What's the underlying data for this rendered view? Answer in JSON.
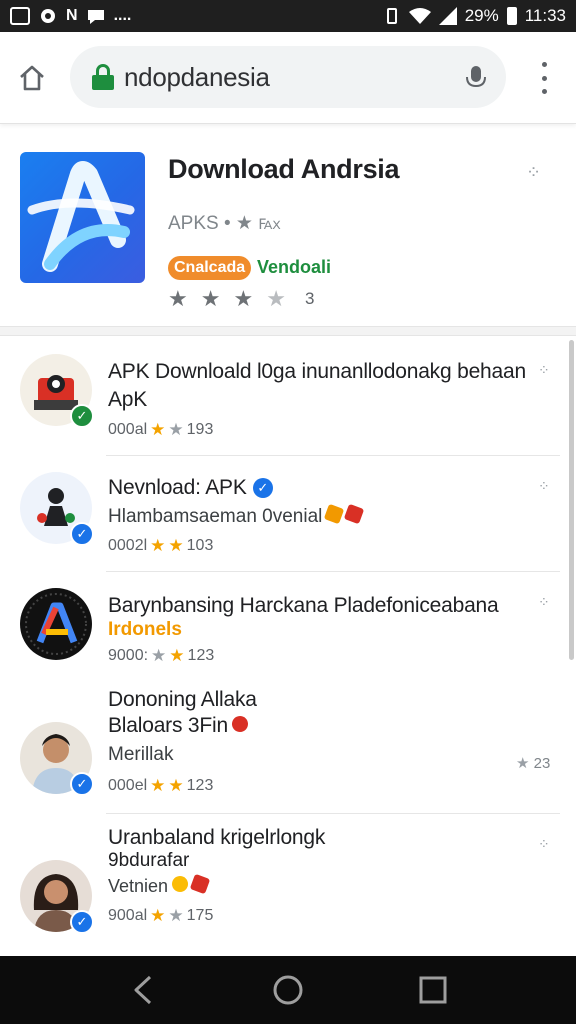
{
  "status_bar": {
    "left_glyphs": [
      "N",
      "...."
    ],
    "battery_text": "29%",
    "time": "11:33"
  },
  "browser": {
    "url_text": "ndopdanesia",
    "icons": [
      "home-icon",
      "lock-icon",
      "mic-icon",
      "more-vert-icon"
    ]
  },
  "featured": {
    "title": "Download Andrsia",
    "meta": "APKS • ★ ℻",
    "badge": "Cnalcada",
    "status": "Vendoali",
    "rating_value": "3",
    "stars_filled": 3,
    "accent_color": "#f08c2b"
  },
  "list": [
    {
      "title_line1": "APK Downloald l0ga inunanllodonakg behaan",
      "title_line2": "ApK",
      "rating_prefix": "000al",
      "rating_count": "193"
    },
    {
      "title_line1": "Nevnload: APK",
      "sub": "Hlambamsaeman 0venial",
      "rating_prefix": "0002l",
      "rating_count": "103"
    },
    {
      "title_line1": "Barynbansing Harckana Pladefoniceabana",
      "sub": "Irdonels",
      "rating_prefix": "9000:",
      "rating_count": "123"
    },
    {
      "title_line1": "Dononing Allaka",
      "title_line2": "Blaloars 3Fin",
      "sub": "Merillak",
      "rating_prefix": "000el",
      "rating_count": "123",
      "side_rating": "23"
    },
    {
      "title_line1": "Uranbaland krigelrlongk",
      "title_line2": "9bdurafar",
      "sub": "Vetnien",
      "rating_prefix": "900al",
      "rating_count": "175"
    }
  ],
  "nav": {
    "icons": [
      "back-icon",
      "home-circle-icon",
      "recents-icon"
    ]
  }
}
